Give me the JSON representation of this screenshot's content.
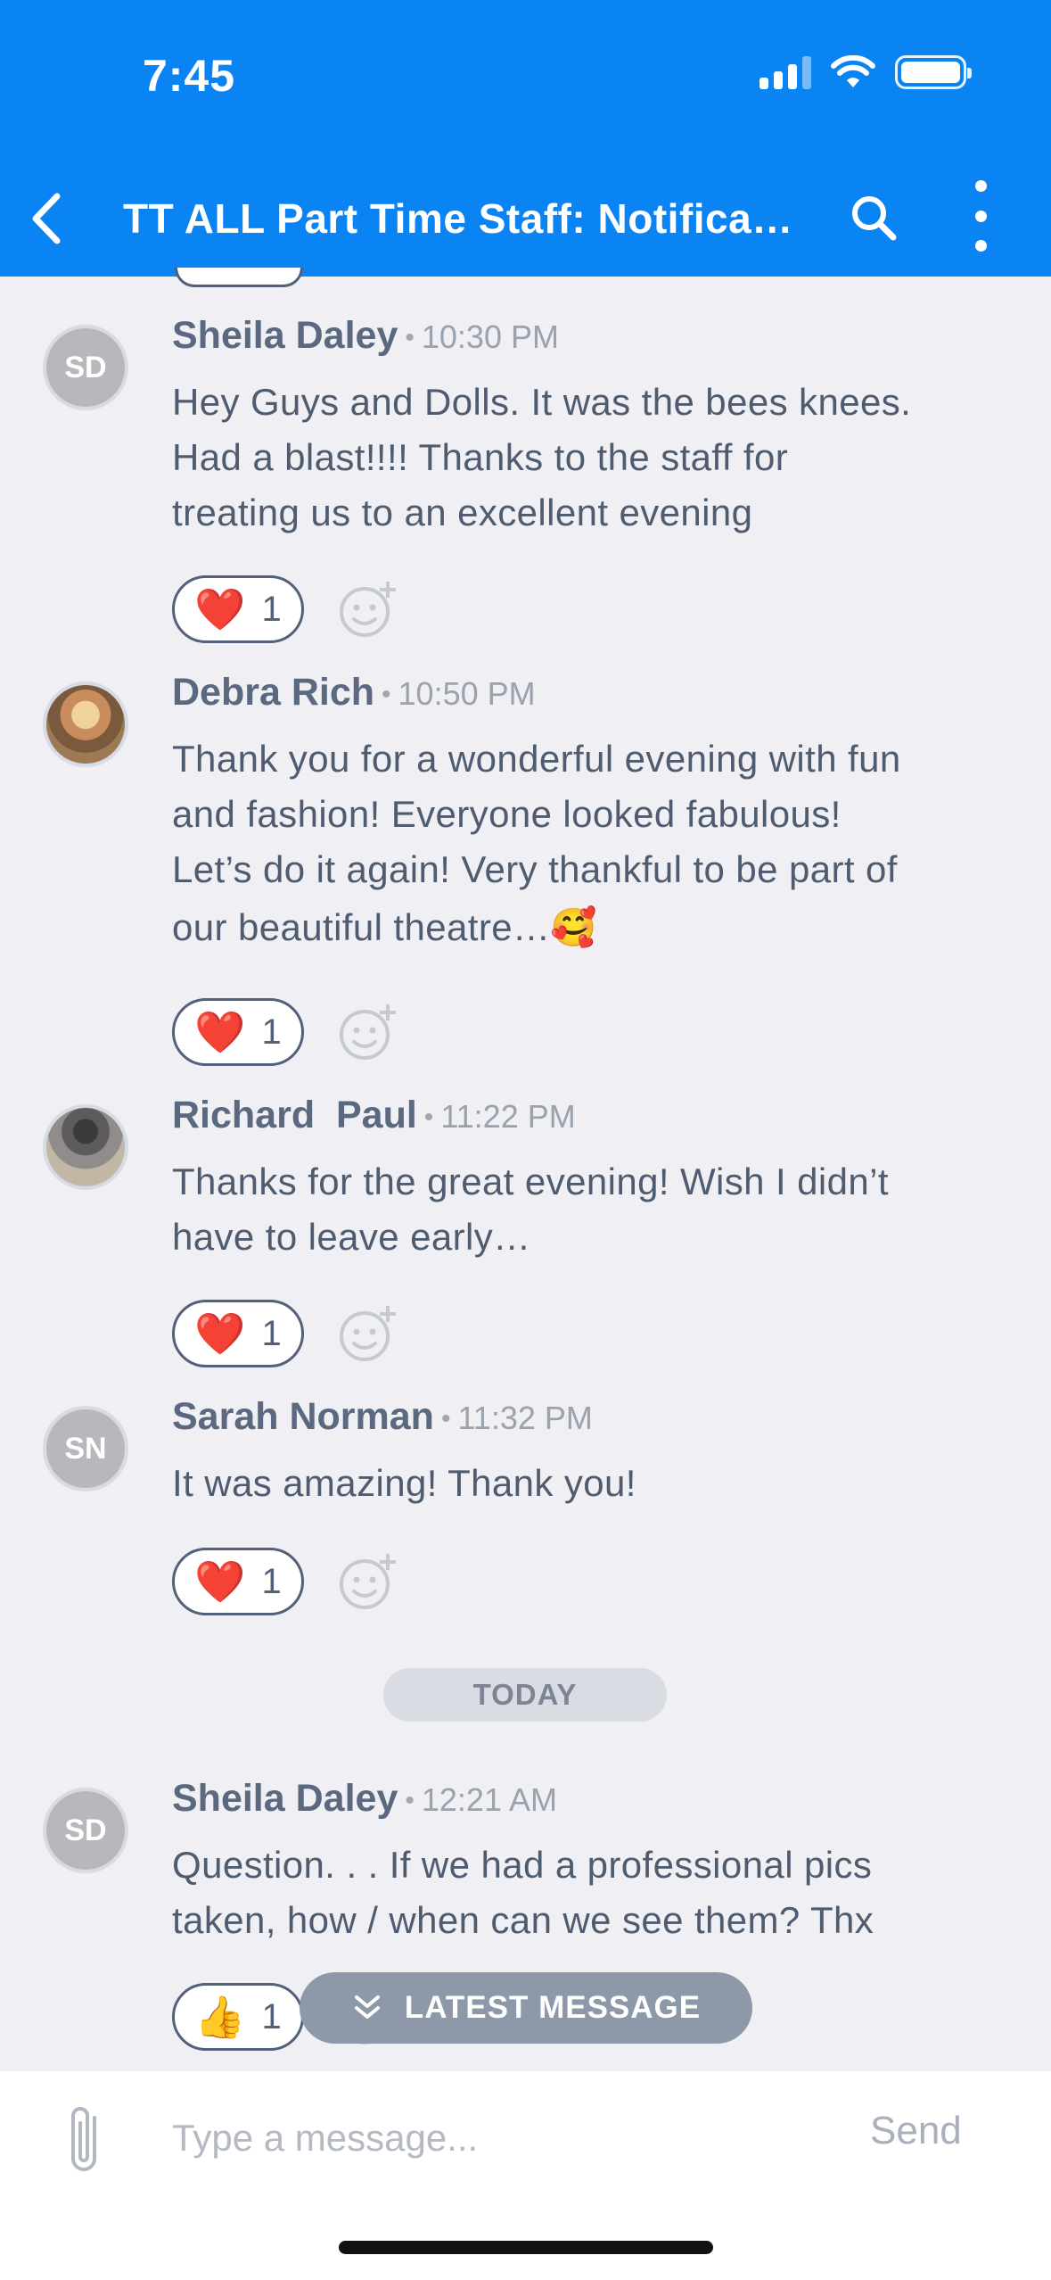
{
  "status_bar": {
    "time": "7:45"
  },
  "nav": {
    "title": "TT ALL Part Time Staff: Notifica…"
  },
  "messages": [
    {
      "initials": "SD",
      "name": "Sheila Daley",
      "time": "10:30 PM",
      "lines": [
        "Hey Guys and Dolls.  It was the bees knees.",
        "Had a blast!!!!  Thanks to the staff for",
        "treating us to an excellent evening"
      ],
      "reaction": {
        "emoji": "❤️",
        "count": "1"
      }
    },
    {
      "initials": "",
      "name": "Debra Rich",
      "time": "10:50 PM",
      "lines": [
        "Thank you for a wonderful evening with fun",
        "and fashion! Everyone looked fabulous!",
        "Let’s do it again! Very thankful to be part of",
        "our beautiful theatre…🥰"
      ],
      "reaction": {
        "emoji": "❤️",
        "count": "1"
      }
    },
    {
      "initials": "",
      "name": "Richard  Paul",
      "time": "11:22 PM",
      "lines": [
        "Thanks for the great evening! Wish I didn’t",
        "have to leave early…"
      ],
      "reaction": {
        "emoji": "❤️",
        "count": "1"
      }
    },
    {
      "initials": "SN",
      "name": "Sarah Norman",
      "time": "11:32 PM",
      "lines": [
        "It was amazing! Thank you!"
      ],
      "reaction": {
        "emoji": "❤️",
        "count": "1"
      }
    },
    {
      "initials": "SD",
      "name": "Sheila Daley",
      "time": "12:21 AM",
      "lines": [
        "Question.  . . If we had a professional pics",
        "taken, how / when can we see them?  Thx"
      ],
      "reaction": {
        "emoji": "👍",
        "count": "1"
      }
    }
  ],
  "separator": {
    "label": "TODAY"
  },
  "latest_button": {
    "label": "LATEST MESSAGE"
  },
  "composer": {
    "placeholder": "Type a message...",
    "send_label": "Send"
  },
  "colors": {
    "header": "#0a84f2",
    "background": "#efeff4",
    "text": "#4f5c70"
  }
}
